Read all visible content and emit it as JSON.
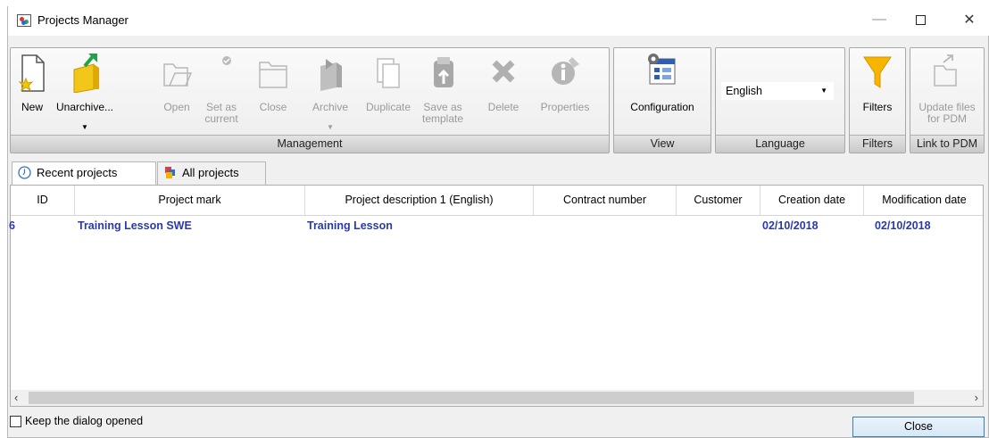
{
  "window": {
    "title": "Projects Manager"
  },
  "ribbon": {
    "management": {
      "label": "Management",
      "new": "New",
      "unarchive": "Unarchive...",
      "open": "Open",
      "set_as_current": "Set as current",
      "close": "Close",
      "archive": "Archive",
      "duplicate": "Duplicate",
      "save_as_template": "Save as template",
      "delete": "Delete",
      "properties": "Properties"
    },
    "view": {
      "label": "View",
      "configuration": "Configuration"
    },
    "language": {
      "label": "Language",
      "selected": "English"
    },
    "filters": {
      "label": "Filters",
      "filters_btn": "Filters"
    },
    "pdm": {
      "label": "Link to PDM",
      "update": "Update files for PDM"
    }
  },
  "tabs": {
    "recent": "Recent projects",
    "all": "All projects"
  },
  "table": {
    "columns": [
      "ID",
      "Project mark",
      "Project description 1 (English)",
      "Contract number",
      "Customer",
      "Creation date",
      "Modification date"
    ],
    "rows": [
      {
        "id": "6",
        "mark": "Training Lesson SWE",
        "description": "Training Lesson",
        "contract": "",
        "customer": "",
        "created": "02/10/2018",
        "modified": "02/10/2018"
      }
    ]
  },
  "footer": {
    "keep_open": "Keep the dialog opened",
    "close": "Close"
  },
  "icons": [
    "app-icon",
    "new-icon",
    "unarchive-icon",
    "open-icon",
    "set-current-icon",
    "close-project-icon",
    "archive-icon",
    "duplicate-icon",
    "save-template-icon",
    "delete-icon",
    "properties-icon",
    "configuration-icon",
    "filter-icon",
    "update-pdm-icon",
    "clock-icon",
    "all-projects-icon"
  ]
}
